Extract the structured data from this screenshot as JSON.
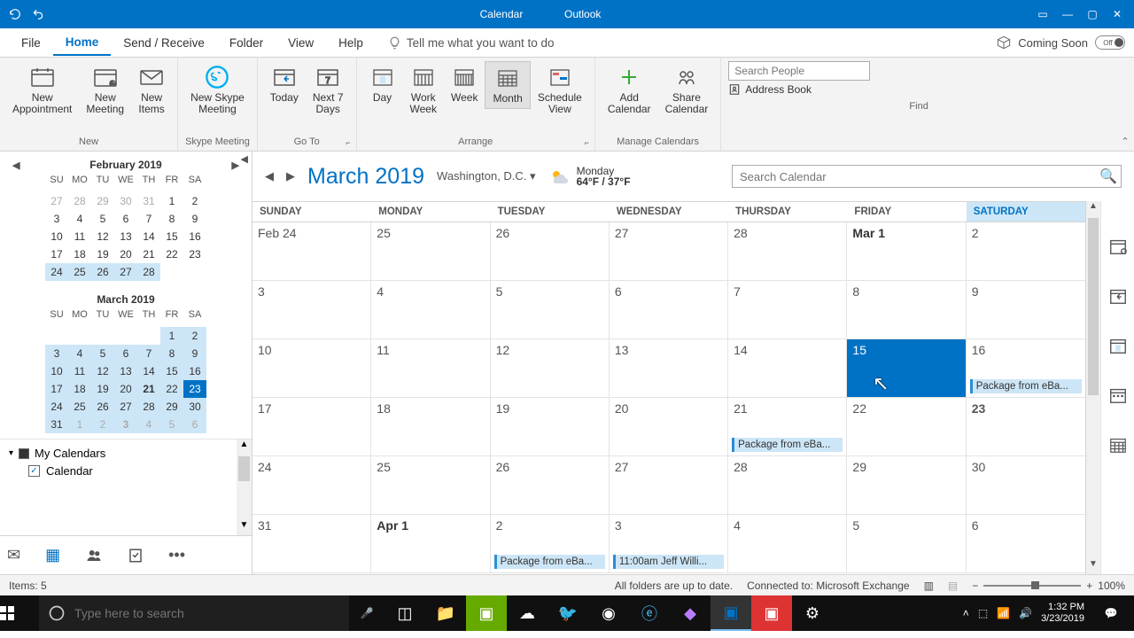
{
  "title_bar": {
    "app_section": "Calendar",
    "app_name": "Outlook"
  },
  "menu": {
    "tabs": [
      "File",
      "Home",
      "Send / Receive",
      "Folder",
      "View",
      "Help"
    ],
    "active": 1,
    "tell_me": "Tell me what you want to do",
    "coming": "Coming Soon",
    "toggle": "Off"
  },
  "ribbon": {
    "new": {
      "label": "New",
      "appointment": "New\nAppointment",
      "meeting": "New\nMeeting",
      "items": "New\nItems"
    },
    "skype": {
      "label": "Skype Meeting",
      "btn": "New Skype\nMeeting"
    },
    "goto": {
      "label": "Go To",
      "today": "Today",
      "next7": "Next 7\nDays"
    },
    "arrange": {
      "label": "Arrange",
      "day": "Day",
      "workweek": "Work\nWeek",
      "week": "Week",
      "month": "Month",
      "schedule": "Schedule\nView"
    },
    "manage": {
      "label": "Manage Calendars",
      "add": "Add\nCalendar",
      "share": "Share\nCalendar"
    },
    "find": {
      "label": "Find",
      "search_ph": "Search People",
      "ab": "Address Book"
    }
  },
  "mini": {
    "feb": {
      "title": "February 2019",
      "dow": [
        "SU",
        "MO",
        "TU",
        "WE",
        "TH",
        "FR",
        "SA"
      ],
      "days": [
        [
          "27",
          "o"
        ],
        [
          "28",
          "o"
        ],
        [
          "29",
          "o"
        ],
        [
          "30",
          "o"
        ],
        [
          "31",
          "o"
        ],
        [
          "1",
          ""
        ],
        [
          "2",
          ""
        ],
        [
          "3",
          ""
        ],
        [
          "4",
          ""
        ],
        [
          "5",
          ""
        ],
        [
          "6",
          ""
        ],
        [
          "7",
          ""
        ],
        [
          "8",
          ""
        ],
        [
          "9",
          ""
        ],
        [
          "10",
          ""
        ],
        [
          "11",
          ""
        ],
        [
          "12",
          ""
        ],
        [
          "13",
          ""
        ],
        [
          "14",
          ""
        ],
        [
          "15",
          ""
        ],
        [
          "16",
          ""
        ],
        [
          "17",
          ""
        ],
        [
          "18",
          ""
        ],
        [
          "19",
          ""
        ],
        [
          "20",
          ""
        ],
        [
          "21",
          ""
        ],
        [
          "22",
          ""
        ],
        [
          "23",
          ""
        ],
        [
          "24",
          "h"
        ],
        [
          "25",
          "h"
        ],
        [
          "26",
          "h"
        ],
        [
          "27",
          "h"
        ],
        [
          "28",
          "h"
        ]
      ]
    },
    "mar": {
      "title": "March 2019",
      "dow": [
        "SU",
        "MO",
        "TU",
        "WE",
        "TH",
        "FR",
        "SA"
      ],
      "days": [
        [
          "",
          "e"
        ],
        [
          "",
          "e"
        ],
        [
          "",
          "e"
        ],
        [
          "",
          "e"
        ],
        [
          "",
          "e"
        ],
        [
          "1",
          "h"
        ],
        [
          "2",
          "h"
        ],
        [
          "3",
          "h"
        ],
        [
          "4",
          "h"
        ],
        [
          "5",
          "h"
        ],
        [
          "6",
          "h"
        ],
        [
          "7",
          "h"
        ],
        [
          "8",
          "h"
        ],
        [
          "9",
          "h"
        ],
        [
          "10",
          "h"
        ],
        [
          "11",
          "h"
        ],
        [
          "12",
          "h"
        ],
        [
          "13",
          "h"
        ],
        [
          "14",
          "h"
        ],
        [
          "15",
          "h"
        ],
        [
          "16",
          "h"
        ],
        [
          "17",
          "h"
        ],
        [
          "18",
          "h"
        ],
        [
          "19",
          "h"
        ],
        [
          "20",
          "h"
        ],
        [
          "21",
          "hb"
        ],
        [
          "22",
          "h"
        ],
        [
          "23",
          "s"
        ],
        [
          "24",
          "h"
        ],
        [
          "25",
          "h"
        ],
        [
          "26",
          "h"
        ],
        [
          "27",
          "h"
        ],
        [
          "28",
          "h"
        ],
        [
          "29",
          "h"
        ],
        [
          "30",
          "h"
        ],
        [
          "31",
          "h"
        ],
        [
          "1",
          "ho"
        ],
        [
          "2",
          "ho"
        ],
        [
          "3",
          "hob"
        ],
        [
          "4",
          "ho"
        ],
        [
          "5",
          "ho"
        ],
        [
          "6",
          "ho"
        ]
      ]
    }
  },
  "mycal": {
    "title": "My Calendars",
    "items": [
      {
        "label": "Calendar",
        "checked": true
      }
    ]
  },
  "main": {
    "title": "March 2019",
    "location": "Washington,  D.C.",
    "weather_day": "Monday",
    "weather_temp": "64°F / 37°F",
    "search_ph": "Search Calendar",
    "dow": [
      "SUNDAY",
      "MONDAY",
      "TUESDAY",
      "WEDNESDAY",
      "THURSDAY",
      "FRIDAY",
      "SATURDAY"
    ],
    "weeks": [
      [
        {
          "n": "Feb 24"
        },
        {
          "n": "25"
        },
        {
          "n": "26"
        },
        {
          "n": "27"
        },
        {
          "n": "28"
        },
        {
          "n": "Mar 1",
          "c": "first"
        },
        {
          "n": "2"
        }
      ],
      [
        {
          "n": "3"
        },
        {
          "n": "4"
        },
        {
          "n": "5"
        },
        {
          "n": "6"
        },
        {
          "n": "7"
        },
        {
          "n": "8"
        },
        {
          "n": "9"
        }
      ],
      [
        {
          "n": "10"
        },
        {
          "n": "11"
        },
        {
          "n": "12"
        },
        {
          "n": "13"
        },
        {
          "n": "14"
        },
        {
          "n": "15",
          "c": "sel"
        },
        {
          "n": "16",
          "ev": "Package from eBa..."
        }
      ],
      [
        {
          "n": "17"
        },
        {
          "n": "18"
        },
        {
          "n": "19"
        },
        {
          "n": "20"
        },
        {
          "n": "21",
          "ev": "Package from eBa..."
        },
        {
          "n": "22"
        },
        {
          "n": "23",
          "c": "sat"
        }
      ],
      [
        {
          "n": "24"
        },
        {
          "n": "25"
        },
        {
          "n": "26"
        },
        {
          "n": "27"
        },
        {
          "n": "28"
        },
        {
          "n": "29"
        },
        {
          "n": "30"
        }
      ],
      [
        {
          "n": "31"
        },
        {
          "n": "Apr 1",
          "c": "first"
        },
        {
          "n": "2",
          "ev": "Package from eBa..."
        },
        {
          "n": "3",
          "ev": "11:00am Jeff Willi..."
        },
        {
          "n": "4"
        },
        {
          "n": "5"
        },
        {
          "n": "6"
        }
      ]
    ]
  },
  "status": {
    "items": "Items: 5",
    "folders": "All folders are up to date.",
    "connected": "Connected to: Microsoft Exchange",
    "zoom": "100%"
  },
  "taskbar": {
    "search_ph": "Type here to search",
    "time": "1:32 PM",
    "date": "3/23/2019"
  }
}
